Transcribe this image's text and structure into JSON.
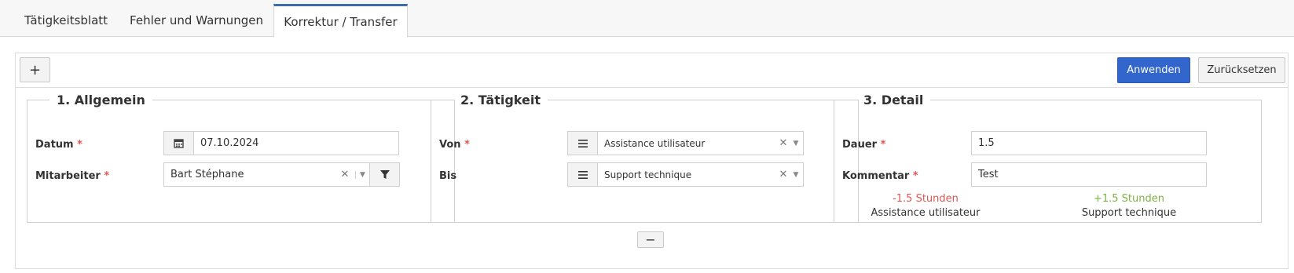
{
  "tabs": [
    {
      "label": "Tätigkeitsblatt"
    },
    {
      "label": "Fehler und Warnungen"
    },
    {
      "label": "Korrektur / Transfer"
    }
  ],
  "toolbar": {
    "add_label": "+",
    "apply_label": "Anwenden",
    "reset_label": "Zurücksetzen"
  },
  "general": {
    "title": "1. Allgemein",
    "date_label": "Datum",
    "date_value": "07.10.2024",
    "employee_label": "Mitarbeiter",
    "employee_value": "Bart Stéphane"
  },
  "activity": {
    "title": "2. Tätigkeit",
    "from_label": "Von",
    "from_value": "Assistance utilisateur",
    "to_label": "Bis",
    "to_value": "Support technique"
  },
  "detail": {
    "title": "3. Detail",
    "duration_label": "Dauer",
    "duration_value": "1.5",
    "comment_label": "Kommentar",
    "comment_value": "Test",
    "from_delta": "-1.5 Stunden",
    "from_name": "Assistance utilisateur",
    "to_delta": "+1.5 Stunden",
    "to_name": "Support technique"
  },
  "required_marker": "*",
  "collapse_label": "−",
  "colors": {
    "accent": "#3366cc",
    "required": "#e55353",
    "negative": "#e05555",
    "positive": "#7cb342",
    "active_tab_border": "#3c6ea9"
  },
  "icons": [
    "calendar-icon",
    "list-icon",
    "filter-icon",
    "clear-icon",
    "caret-down-icon"
  ]
}
